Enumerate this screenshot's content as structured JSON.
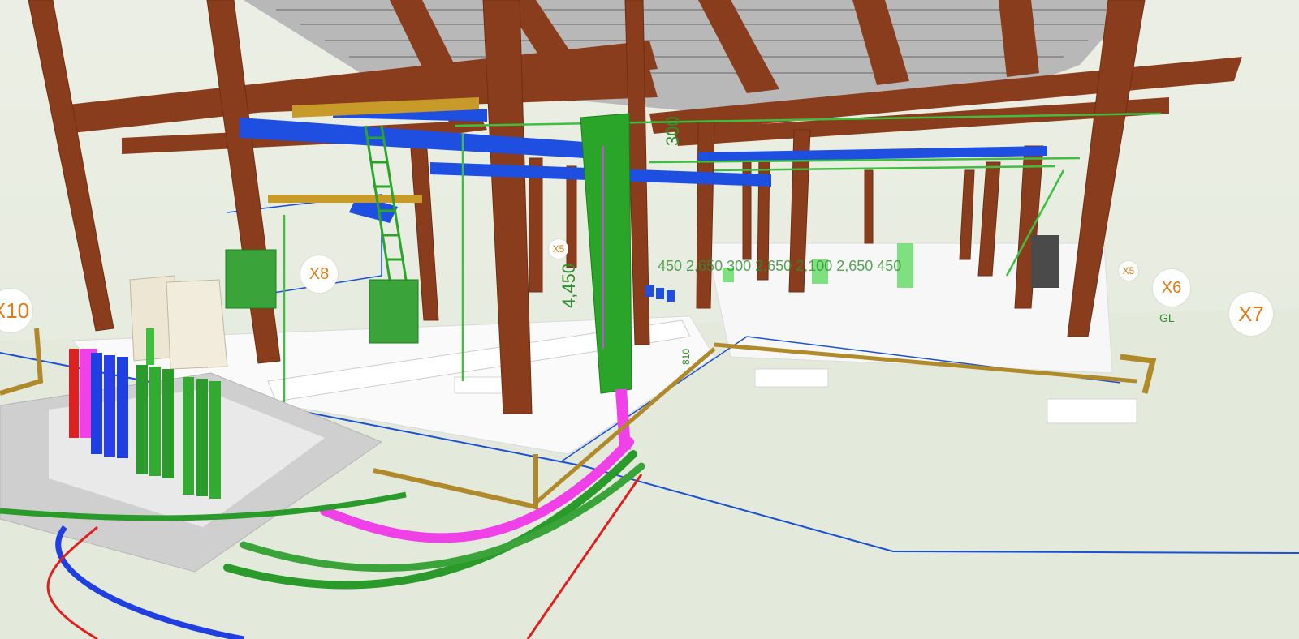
{
  "grid_labels": {
    "x10": "X10",
    "x8": "X8",
    "x5_left": "X5",
    "x6": "X6",
    "x7": "X7",
    "x5_right": "X5"
  },
  "dimension_labels": {
    "main_riser_height": "4,450",
    "upper_height": "300",
    "side_dim": "810",
    "row_dims": "450  2,650  300  2,650  2,100  2,650  450"
  },
  "level_label": "GL",
  "colors": {
    "steel": "#8a3d1c",
    "steel_dark": "#6e2e13",
    "duct_blue": "#1f4fe0",
    "pipe_green": "#2aa52a",
    "pipe_magenta": "#f040e8",
    "pipe_gold": "#b08a2a",
    "pipe_red": "#e02020",
    "concrete": "#f4f4f4",
    "grid_line": "#1b4fd6"
  }
}
